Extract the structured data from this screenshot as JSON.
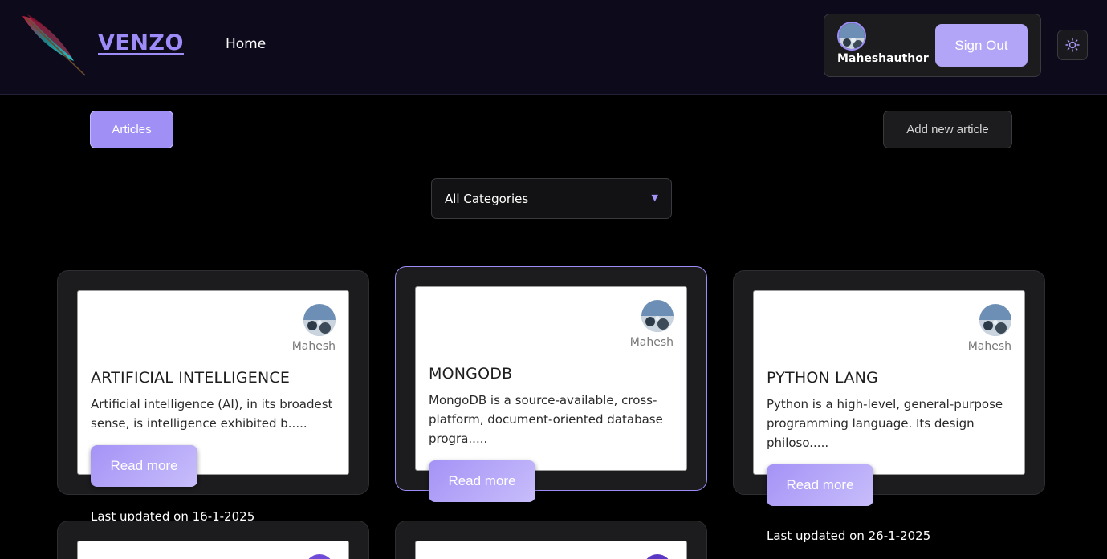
{
  "header": {
    "brand": "VENZO",
    "nav_home": "Home",
    "user": {
      "name": "Maheshauthor"
    },
    "sign_out_label": "Sign Out",
    "theme_icon": "sun-icon"
  },
  "toolbar": {
    "articles_label": "Articles",
    "add_article_label": "Add new article"
  },
  "category_filter": {
    "selected": "All Categories",
    "arrow": "▼"
  },
  "articles": [
    {
      "author": "Mahesh",
      "title": "ARTIFICIAL INTELLIGENCE",
      "description": "Artificial intelligence (AI), in its broadest sense, is intelligence exhibited b.....",
      "read_more": "Read more",
      "updated": "Last updated on 16-1-2025"
    },
    {
      "author": "Mahesh",
      "title": "MONGODB",
      "description": "MongoDB is a source-available, cross-platform, document-oriented database progra.....",
      "read_more": "Read more"
    },
    {
      "author": "Mahesh",
      "title": "PYTHON LANG",
      "description": "Python is a high-level, general-purpose programming language. Its design philoso.....",
      "read_more": "Read more",
      "updated": "Last updated on 26-1-2025"
    }
  ],
  "colors": {
    "accent": "#9d8cf7",
    "header_bg": "#0d0a1c",
    "card_bg": "#1c1c1e"
  }
}
